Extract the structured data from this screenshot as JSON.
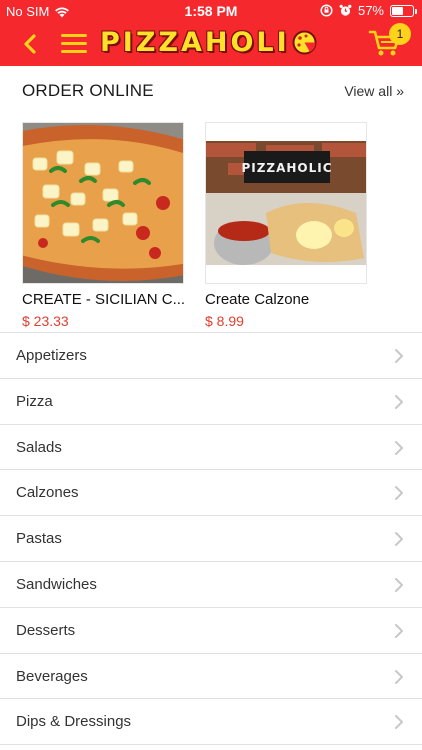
{
  "status_bar": {
    "carrier": "No SIM",
    "time": "1:58 PM",
    "battery": "57%",
    "battery_level": 0.57,
    "icons": [
      "wifi-icon",
      "orientation-lock-icon",
      "alarm-icon",
      "battery-icon"
    ]
  },
  "nav": {
    "logo_text": "PIZZAHOLI",
    "cart_count": "1",
    "icons": [
      "back-chevron-icon",
      "hamburger-menu-icon",
      "pizza-logo-icon",
      "cart-icon"
    ]
  },
  "order_online": {
    "title": "ORDER ONLINE",
    "view_all": "View all »",
    "items": [
      {
        "name": "CREATE - SICILIAN C...",
        "price": "$ 23.33"
      },
      {
        "name": "Create Calzone",
        "price": "$ 8.99"
      }
    ],
    "calzone_image_brand": "PIZZAHOLIC"
  },
  "categories": [
    {
      "label": "Appetizers"
    },
    {
      "label": "Pizza"
    },
    {
      "label": "Salads"
    },
    {
      "label": "Calzones"
    },
    {
      "label": "Pastas"
    },
    {
      "label": "Sandwiches"
    },
    {
      "label": "Desserts"
    },
    {
      "label": "Beverages"
    },
    {
      "label": "Dips & Dressings"
    }
  ],
  "colors": {
    "header_red": "#f5282d",
    "accent_yellow": "#ffd31a",
    "price_red": "#e0402f"
  }
}
